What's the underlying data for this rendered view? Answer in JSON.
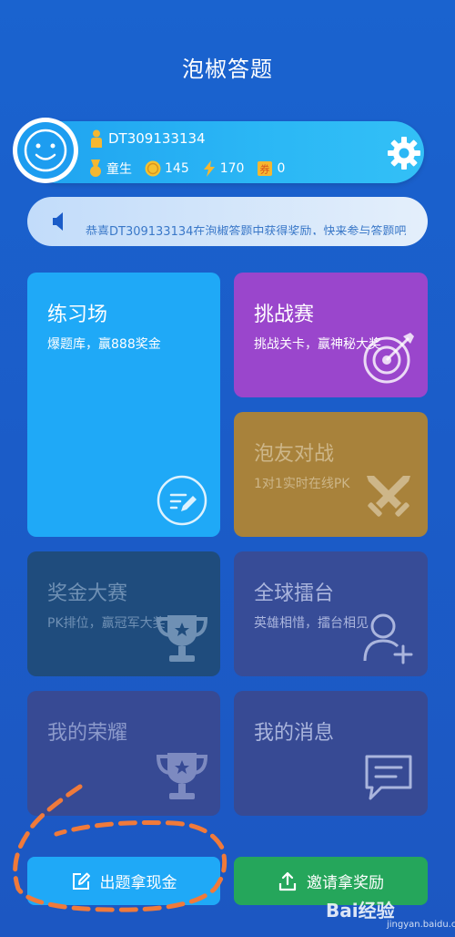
{
  "header": {
    "title": "泡椒答题"
  },
  "profile": {
    "user_id": "DT309133134",
    "rank": "童生",
    "coins": "145",
    "energy": "170",
    "tickets": "0"
  },
  "notice": {
    "text": "恭喜DT309133134在泡椒答题中获得奖励，快来参与答题吧"
  },
  "tiles": {
    "practice": {
      "title": "练习场",
      "subtitle": "爆题库，赢888奖金"
    },
    "challenge": {
      "title": "挑战赛",
      "subtitle": "挑战关卡，赢神秘大奖"
    },
    "friend": {
      "title": "泡友对战",
      "subtitle": "1对1实时在线PK"
    },
    "prize": {
      "title": "奖金大赛",
      "subtitle": "PK排位，赢冠军大奖"
    },
    "arena": {
      "title": "全球擂台",
      "subtitle": "英雄相惜，擂台相见"
    },
    "honor": {
      "title": "我的荣耀"
    },
    "messages": {
      "title": "我的消息"
    }
  },
  "buttons": {
    "question": "出题拿现金",
    "invite": "邀请拿奖励"
  },
  "watermark": {
    "main": "Bai经验",
    "sub": "jingyan.baidu.com"
  },
  "colors": {
    "background": "#1b5cc8",
    "practice": "#1fa9f7",
    "challenge": "#9a46cc",
    "friend": "#a8823b",
    "invite": "#25a65b",
    "highlight": "#f07a3a"
  }
}
